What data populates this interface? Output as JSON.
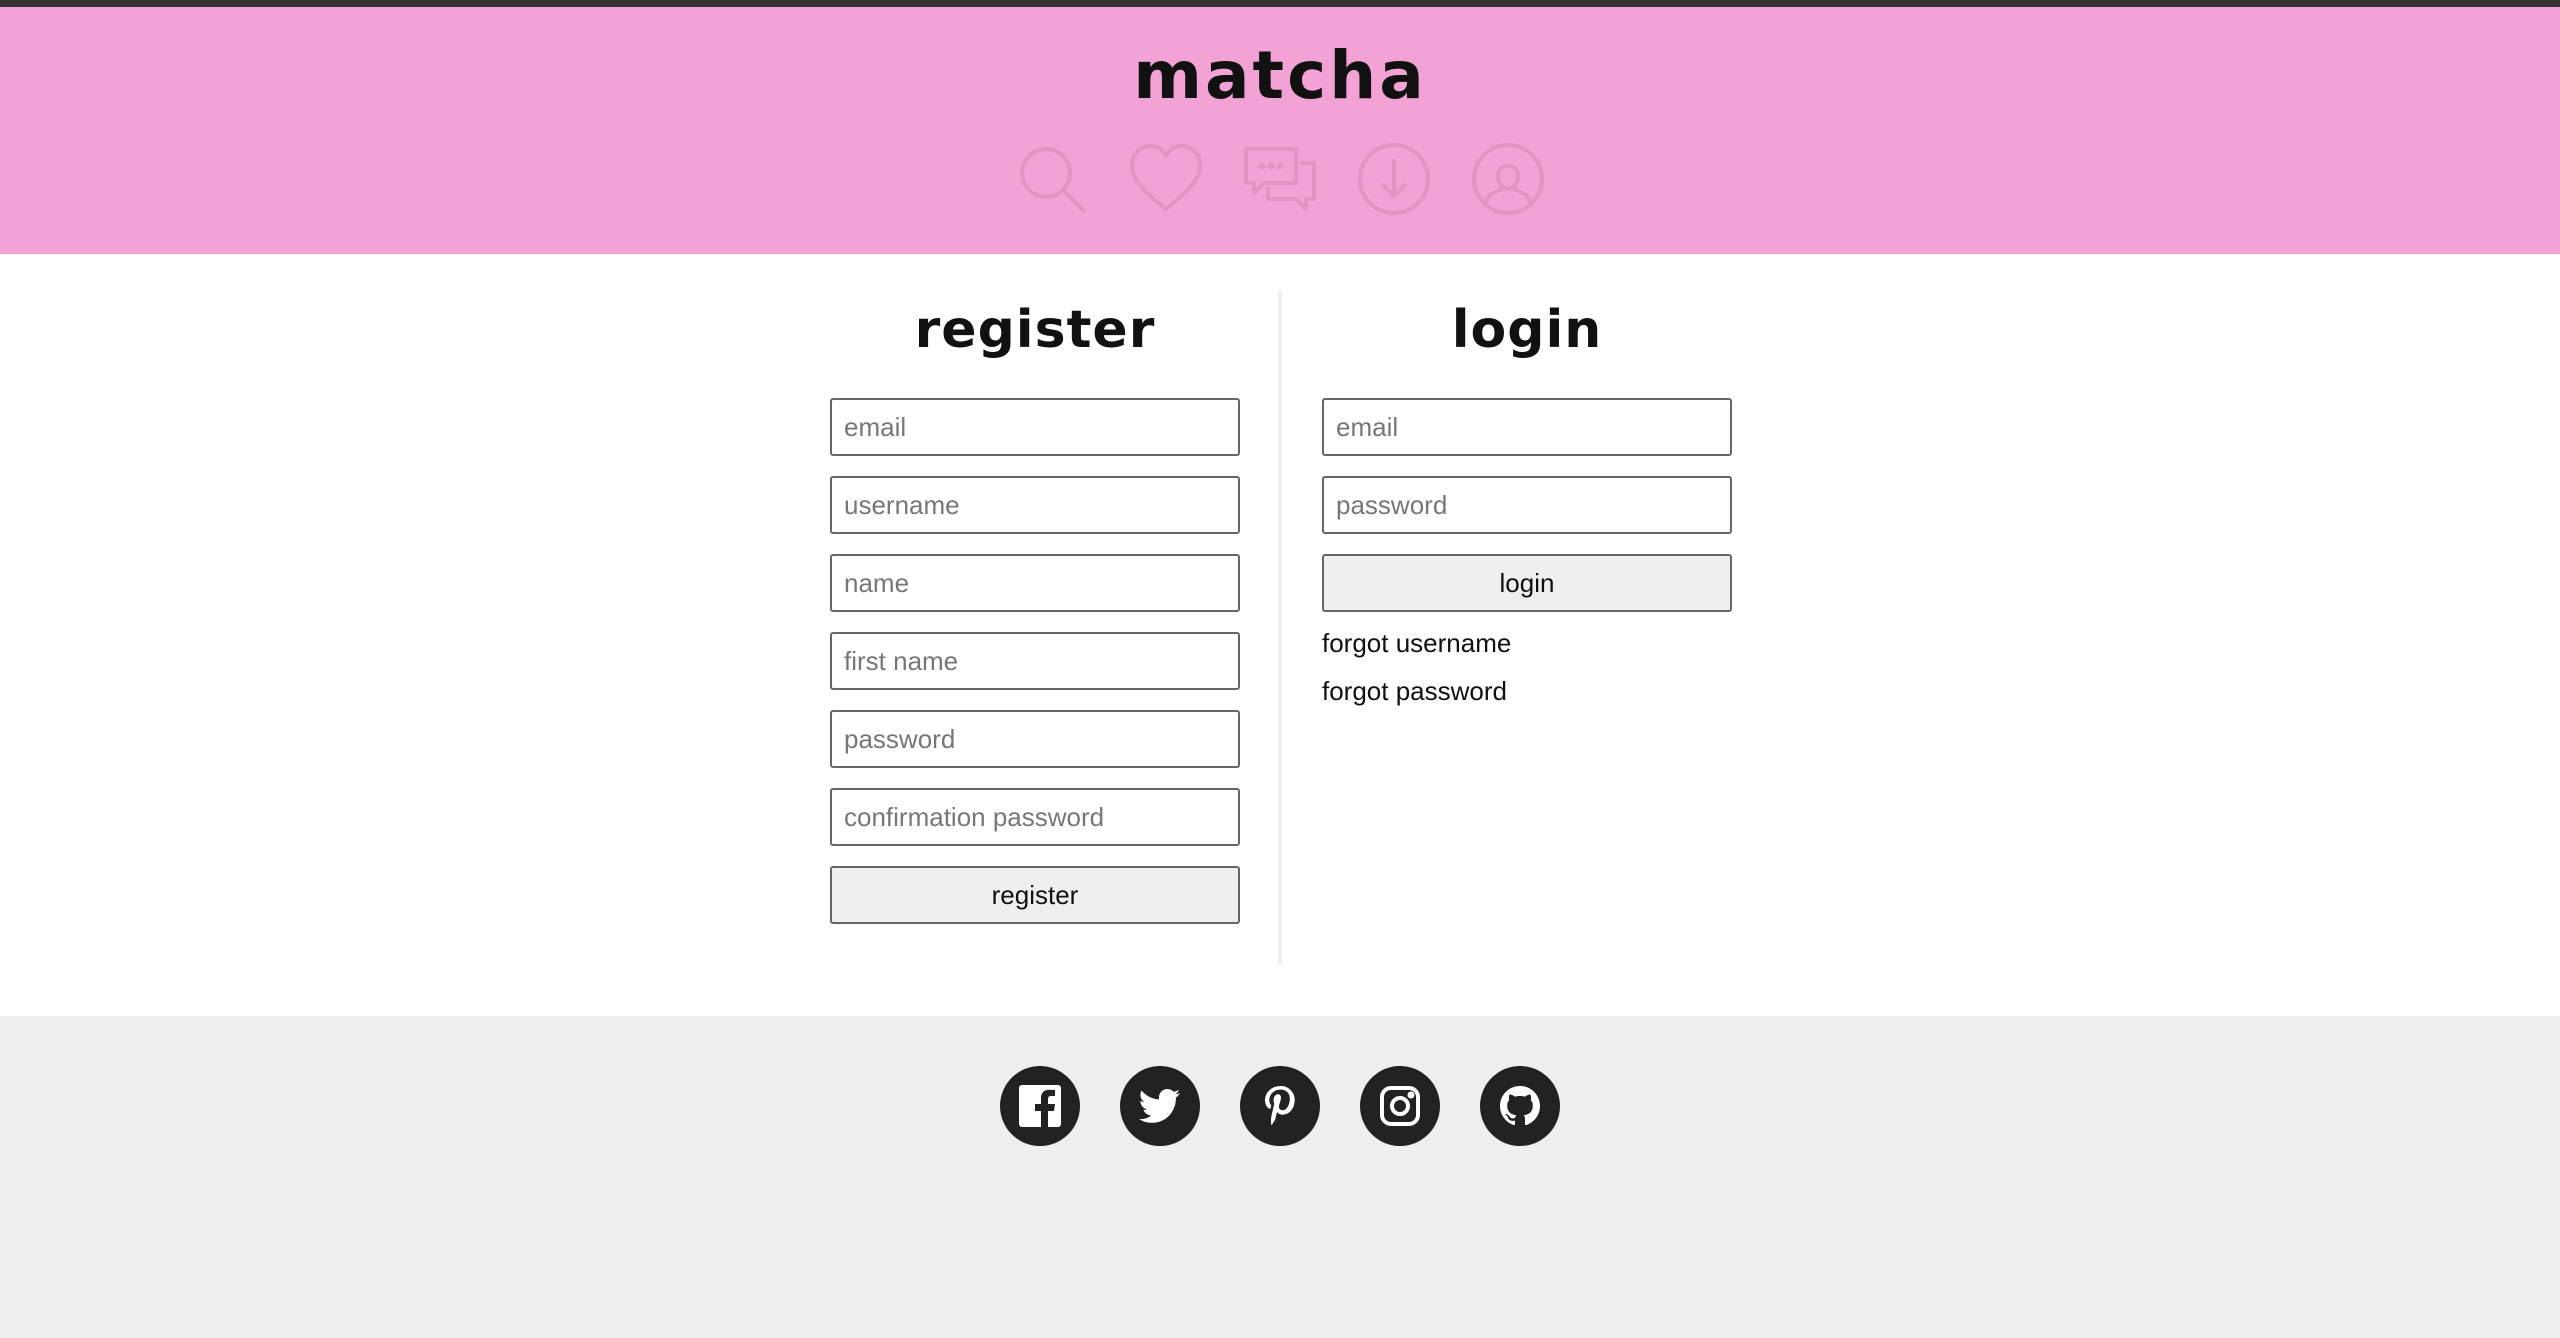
{
  "app": {
    "brand": "matcha"
  },
  "nav": {
    "icons": [
      "search-icon",
      "heart-icon",
      "chat-icon",
      "download-icon",
      "profile-icon"
    ]
  },
  "register": {
    "title": "register",
    "fields": [
      {
        "placeholder": "email",
        "value": ""
      },
      {
        "placeholder": "username",
        "value": ""
      },
      {
        "placeholder": "name",
        "value": ""
      },
      {
        "placeholder": "first name",
        "value": ""
      },
      {
        "placeholder": "password",
        "value": ""
      },
      {
        "placeholder": "confirmation password",
        "value": ""
      }
    ],
    "submit_label": "register"
  },
  "login": {
    "title": "login",
    "fields": [
      {
        "placeholder": "email",
        "value": ""
      },
      {
        "placeholder": "password",
        "value": ""
      }
    ],
    "submit_label": "login",
    "links": [
      "forgot username",
      "forgot password"
    ]
  },
  "footer": {
    "social": [
      "facebook-icon",
      "twitter-icon",
      "pinterest-icon",
      "instagram-icon",
      "github-icon"
    ]
  },
  "colors": {
    "header_bg": "#f2a2d5",
    "nav_icon": "#e592c4",
    "footer_bg": "#eeeeee",
    "social_bg": "#222222"
  }
}
